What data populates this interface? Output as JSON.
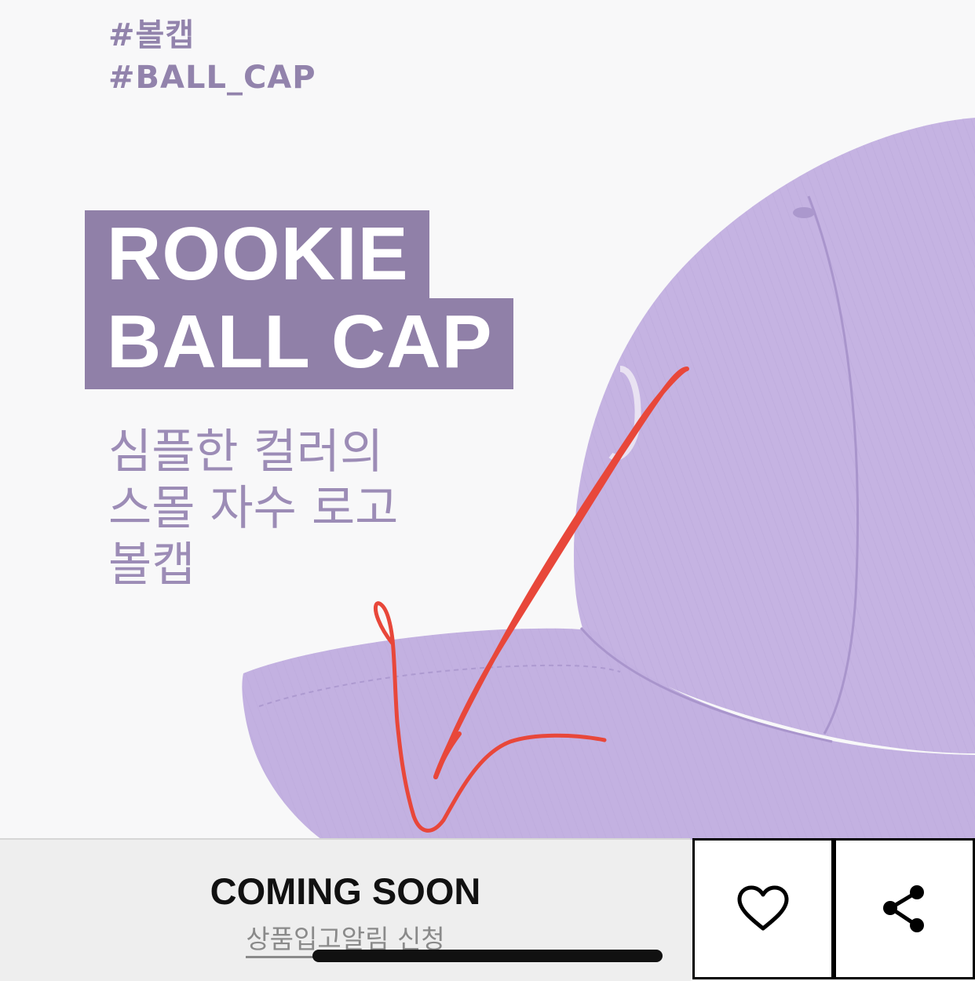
{
  "hero": {
    "hashtags": [
      "#볼캡",
      "#BALL_CAP"
    ],
    "title_lines": [
      "ROOKIE",
      "BALL CAP"
    ],
    "subtitle_lines": [
      "심플한 컬러의",
      "스몰 자수 로고",
      "볼캡"
    ],
    "colors": {
      "accent": "#9080a8",
      "cap": "#c2b0e0",
      "annotation": "#e8473a"
    }
  },
  "bottom_bar": {
    "status_label": "COMING SOON",
    "restock_link": "상품입고알림 신청",
    "wishlist_icon": "heart-icon",
    "share_icon": "share-icon"
  }
}
